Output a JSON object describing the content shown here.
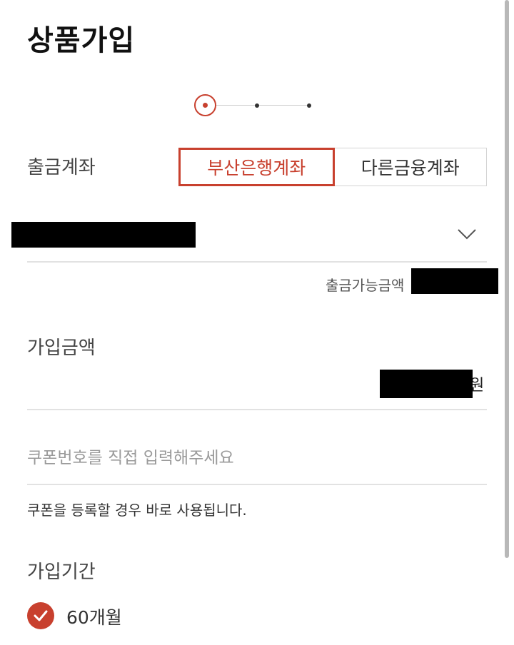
{
  "header": {
    "title": "상품가입"
  },
  "withdrawal": {
    "label": "출금계좌",
    "options": [
      "부산은행계좌",
      "다른금융계좌"
    ],
    "selected_option": "부산은행계좌",
    "available_label": "출금가능금액"
  },
  "amount": {
    "label": "가입금액",
    "unit": "원"
  },
  "coupon": {
    "placeholder": "쿠폰번호를 직접 입력해주세요",
    "note": "쿠폰을 등록할 경우 바로 사용됩니다."
  },
  "period": {
    "label": "가입기간",
    "option": "60개월"
  },
  "colors": {
    "accent": "#c8402e",
    "divider": "#e2e2e2"
  },
  "icons": {
    "dropdown": "chevron-down-icon",
    "check": "check-circle-icon"
  }
}
